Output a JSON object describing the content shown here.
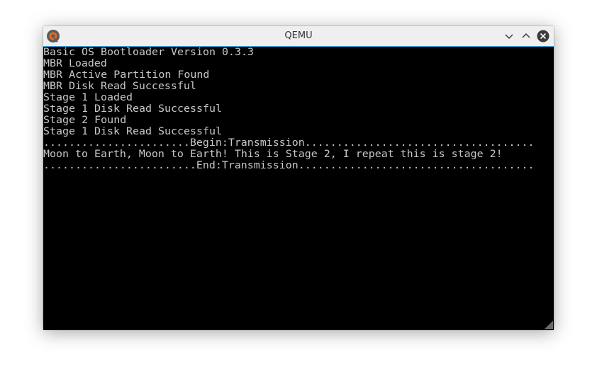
{
  "window": {
    "title": "QEMU",
    "accent_color": "#3daee9",
    "icons": {
      "app": "qemu-logo-icon",
      "minimize": "chevron-down-icon",
      "maximize": "chevron-up-icon",
      "close": "close-icon"
    }
  },
  "console": {
    "text_color": "#c8c8c8",
    "background_color": "#000000",
    "lines": [
      "Basic OS Bootloader Version 0.3.3",
      "MBR Loaded",
      "MBR Active Partition Found",
      "MBR Disk Read Successful",
      "Stage 1 Loaded",
      "Stage 1 Disk Read Successful",
      "Stage 2 Found",
      "Stage 1 Disk Read Successful",
      ".......................Begin:Transmission....................................",
      "Moon to Earth, Moon to Earth! This is Stage 2, I repeat this is stage 2!",
      "........................End:Transmission....................................."
    ]
  }
}
